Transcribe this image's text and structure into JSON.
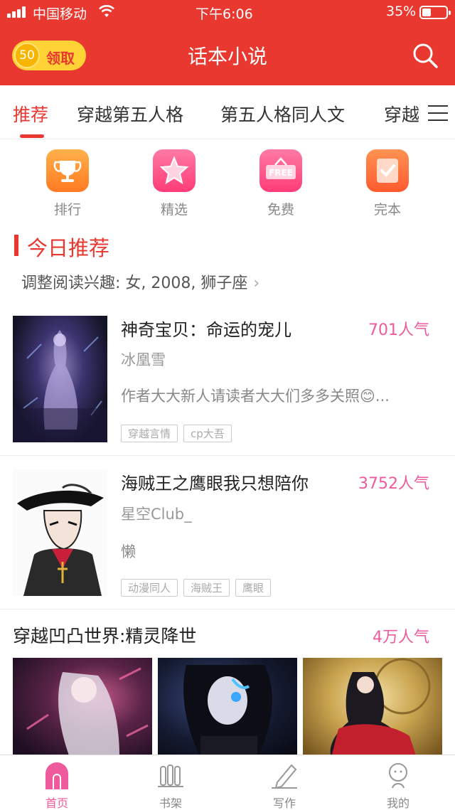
{
  "status_bar": {
    "carrier": "中国移动",
    "time": "下午6:06",
    "battery": "35%"
  },
  "header": {
    "coin_count": "50",
    "coin_action": "领取",
    "title": "话本小说"
  },
  "tabs": [
    {
      "label": "推荐"
    },
    {
      "label": "穿越第五人格"
    },
    {
      "label": "第五人格同人文"
    },
    {
      "label": "穿越"
    }
  ],
  "features": [
    {
      "label": "排行",
      "icon": "trophy-icon",
      "color": "#ff8a2a"
    },
    {
      "label": "精选",
      "icon": "star-icon",
      "color": "#ff4f86"
    },
    {
      "label": "免费",
      "icon": "free-sign-icon",
      "color": "#ff4f86"
    },
    {
      "label": "完本",
      "icon": "check-book-icon",
      "color": "#ff6a3a"
    }
  ],
  "section": {
    "title": "今日推荐",
    "preference": "调整阅读兴趣: 女, 2008, 狮子座"
  },
  "books": [
    {
      "title": "神奇宝贝：命运的宠儿",
      "popularity": "701人气",
      "author": "冰凰雪",
      "desc": "作者大大新人请读者大大们多多关照😊...",
      "tags": [
        "穿越言情",
        "cp大吾"
      ]
    },
    {
      "title": "海贼王之鹰眼我只想陪你",
      "popularity": "3752人气",
      "author": "星空Club_",
      "desc": "懒",
      "tags": [
        "动漫同人",
        "海贼王",
        "鹰眼"
      ]
    }
  ],
  "featured": {
    "title": "穿越凹凸世界:精灵降世",
    "popularity": "4万人气"
  },
  "bottom_nav": [
    {
      "label": "首页"
    },
    {
      "label": "书架"
    },
    {
      "label": "写作"
    },
    {
      "label": "我的"
    }
  ],
  "colors": {
    "brand_red": "#e8382f",
    "popularity_pink": "#ee5a9c"
  }
}
